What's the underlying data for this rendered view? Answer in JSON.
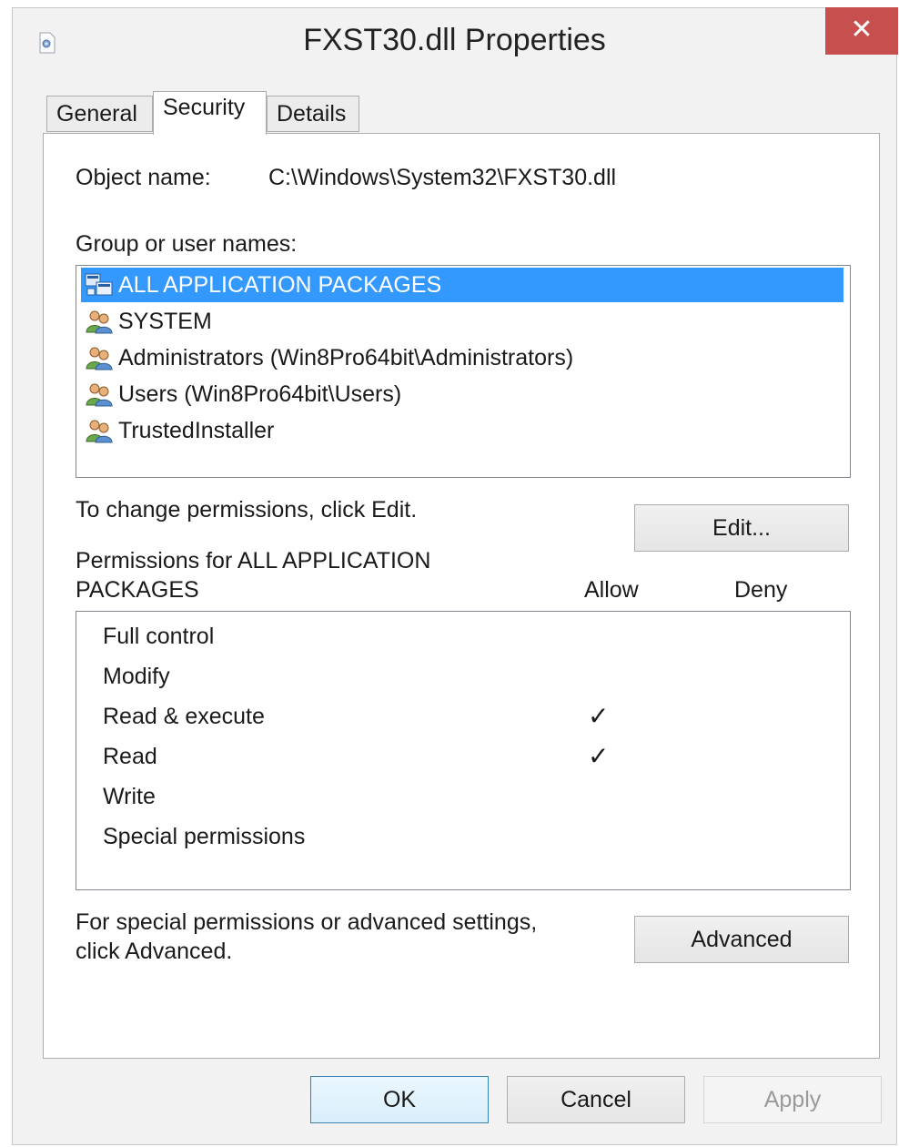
{
  "window": {
    "title": "FXST30.dll Properties",
    "close_glyph": "✕"
  },
  "tabs": [
    {
      "label": "General",
      "active": false
    },
    {
      "label": "Security",
      "active": true
    },
    {
      "label": "Details",
      "active": false
    }
  ],
  "security": {
    "object_name_label": "Object name:",
    "object_name_value": "C:\\Windows\\System32\\FXST30.dll",
    "group_label": "Group or user names:",
    "users": [
      {
        "name": "ALL APPLICATION PACKAGES",
        "icon": "app-packages-icon",
        "selected": true
      },
      {
        "name": "SYSTEM",
        "icon": "users-icon",
        "selected": false
      },
      {
        "name": "Administrators (Win8Pro64bit\\Administrators)",
        "icon": "users-icon",
        "selected": false
      },
      {
        "name": "Users (Win8Pro64bit\\Users)",
        "icon": "users-icon",
        "selected": false
      },
      {
        "name": "TrustedInstaller",
        "icon": "users-icon",
        "selected": false
      }
    ],
    "change_hint": "To change permissions, click Edit.",
    "edit_button": "Edit...",
    "permissions_label_line1": "Permissions for ALL APPLICATION",
    "permissions_label_line2": "PACKAGES",
    "allow_header": "Allow",
    "deny_header": "Deny",
    "permissions": [
      {
        "name": "Full control",
        "allow": "",
        "deny": ""
      },
      {
        "name": "Modify",
        "allow": "",
        "deny": ""
      },
      {
        "name": "Read & execute",
        "allow": "✓",
        "deny": ""
      },
      {
        "name": "Read",
        "allow": "✓",
        "deny": ""
      },
      {
        "name": "Write",
        "allow": "",
        "deny": ""
      },
      {
        "name": "Special permissions",
        "allow": "",
        "deny": ""
      }
    ],
    "advanced_hint_line1": "For special permissions or advanced settings,",
    "advanced_hint_line2": "click Advanced.",
    "advanced_button": "Advanced"
  },
  "footer": {
    "ok_button": "OK",
    "cancel_button": "Cancel",
    "apply_button": "Apply"
  },
  "colors": {
    "selection": "#3399ff",
    "close_button": "#c7504e"
  }
}
